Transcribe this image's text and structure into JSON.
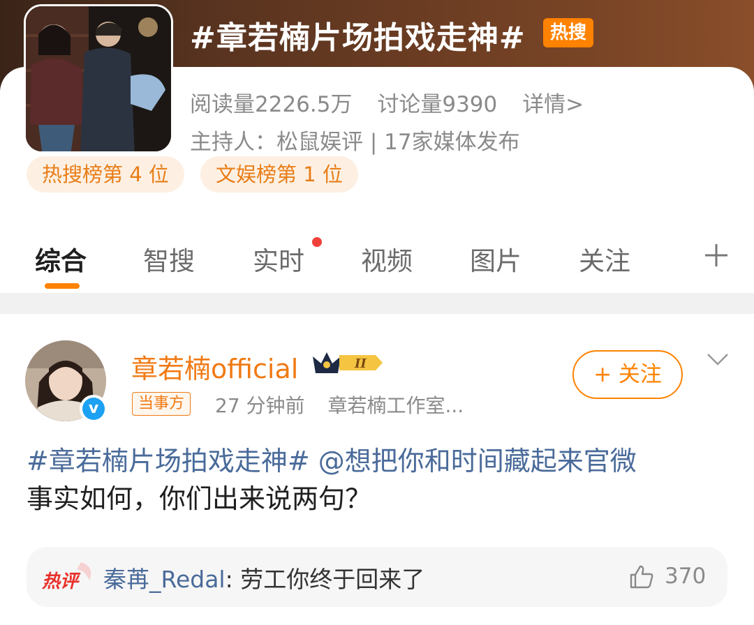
{
  "topic": {
    "title": "#章若楠片场拍戏走神#",
    "badge": "热搜",
    "read_count": "阅读量2226.5万",
    "discussion_count": "讨论量9390",
    "details_link": "详情>",
    "host_line": "主持人：松鼠娱评 | 17家媒体发布",
    "ranks": [
      "热搜榜第 4 位",
      "文娱榜第 1 位"
    ]
  },
  "tabs": [
    "综合",
    "智搜",
    "实时",
    "视频",
    "图片",
    "关注"
  ],
  "active_tab": "综合",
  "post": {
    "username": "章若楠official",
    "vip_level": "II",
    "role_tag": "当事方",
    "time": "27 分钟前",
    "source": "章若楠工作室...",
    "follow_label": "+ 关注",
    "body_hashtag": "#章若楠片场拍戏走神#",
    "body_mention": "@想把你和时间藏起来官微",
    "body_text": "事实如何，你们出来说两句？"
  },
  "hot_comment": {
    "label": "热评",
    "commenter": "秦苒_Redal",
    "separator": ": ",
    "text": "劳工你终于回来了",
    "likes": "370"
  },
  "colors": {
    "accent_orange": "#ff8200",
    "link_blue": "#4a6b9a",
    "username_orange": "#f07a13",
    "notification_red": "#f0423a"
  }
}
